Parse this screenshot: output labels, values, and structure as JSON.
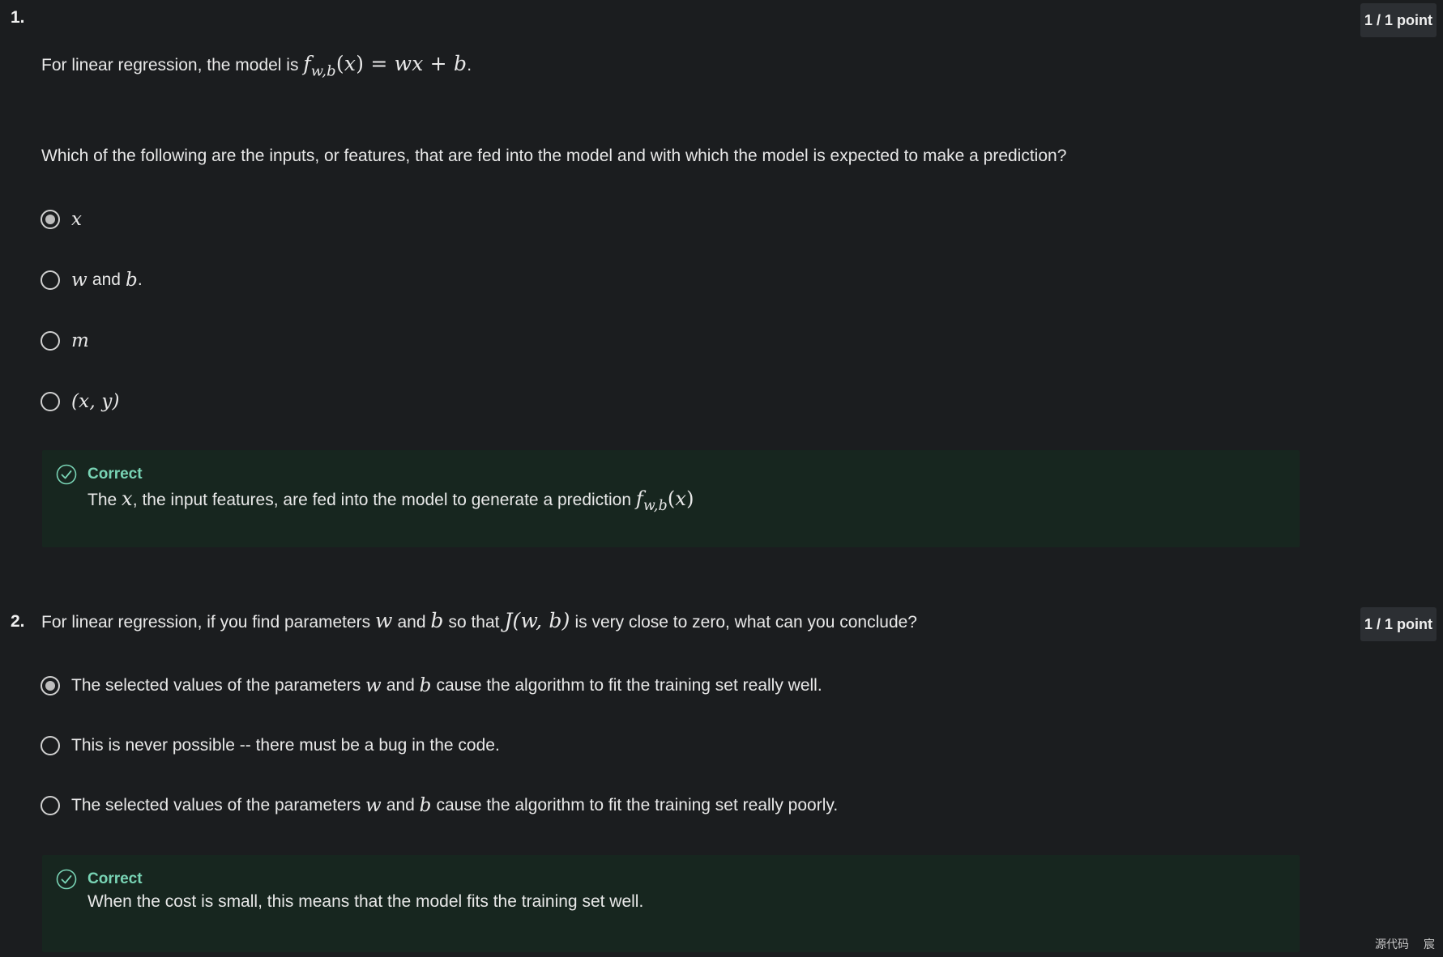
{
  "q1": {
    "number": "1.",
    "points": "1 / 1 point",
    "intro_text": "For linear regression, the model is",
    "intro_math": "f_{w,b}(x) = wx + b",
    "question": "Which of the following are the inputs, or features, that are fed into the model and with which the model is expected to make a prediction?",
    "options": [
      {
        "math": "x",
        "selected": true
      },
      {
        "math_a": "w",
        "text": "and",
        "math_b": "b",
        "suffix": ".",
        "selected": false
      },
      {
        "math": "m",
        "selected": false
      },
      {
        "math": "(x, y)",
        "selected": false
      }
    ],
    "feedback": {
      "title": "Correct",
      "text_before": "The",
      "math_a": "x",
      "text_after": ", the input features, are fed into the model to generate a prediction",
      "math_b": "f_{w,b}(x)"
    }
  },
  "q2": {
    "number": "2.",
    "points": "1 / 1 point",
    "question_parts": {
      "t1": "For linear regression, if you find parameters",
      "m1": "w",
      "t2": "and",
      "m2": "b",
      "t3": "so that",
      "m3": "J(w, b)",
      "t4": "is very close to zero, what can you conclude?"
    },
    "options": [
      {
        "t1": "The selected values of the parameters",
        "m1": "w",
        "t2": "and",
        "m2": "b",
        "t3": "cause the algorithm to fit the training set really well.",
        "selected": true
      },
      {
        "text": "This is never possible -- there must be a bug in the code.",
        "selected": false
      },
      {
        "t1": "The selected values of the parameters",
        "m1": "w",
        "t2": "and",
        "m2": "b",
        "t3": "cause the algorithm to fit the training set really poorly.",
        "selected": false
      }
    ],
    "feedback": {
      "title": "Correct",
      "text": "When the cost is small, this means that the model fits the training set well."
    }
  },
  "corner": {
    "left_text": "源代码",
    "right_text": "宸"
  },
  "colors": {
    "background": "#1b1d1f",
    "feedback_bg": "#17261f",
    "correct_green": "#79d4b5",
    "badge_bg": "#2c2f33"
  },
  "icons": {
    "radio": "radio-button-icon",
    "feedback": "check-circle-icon"
  }
}
